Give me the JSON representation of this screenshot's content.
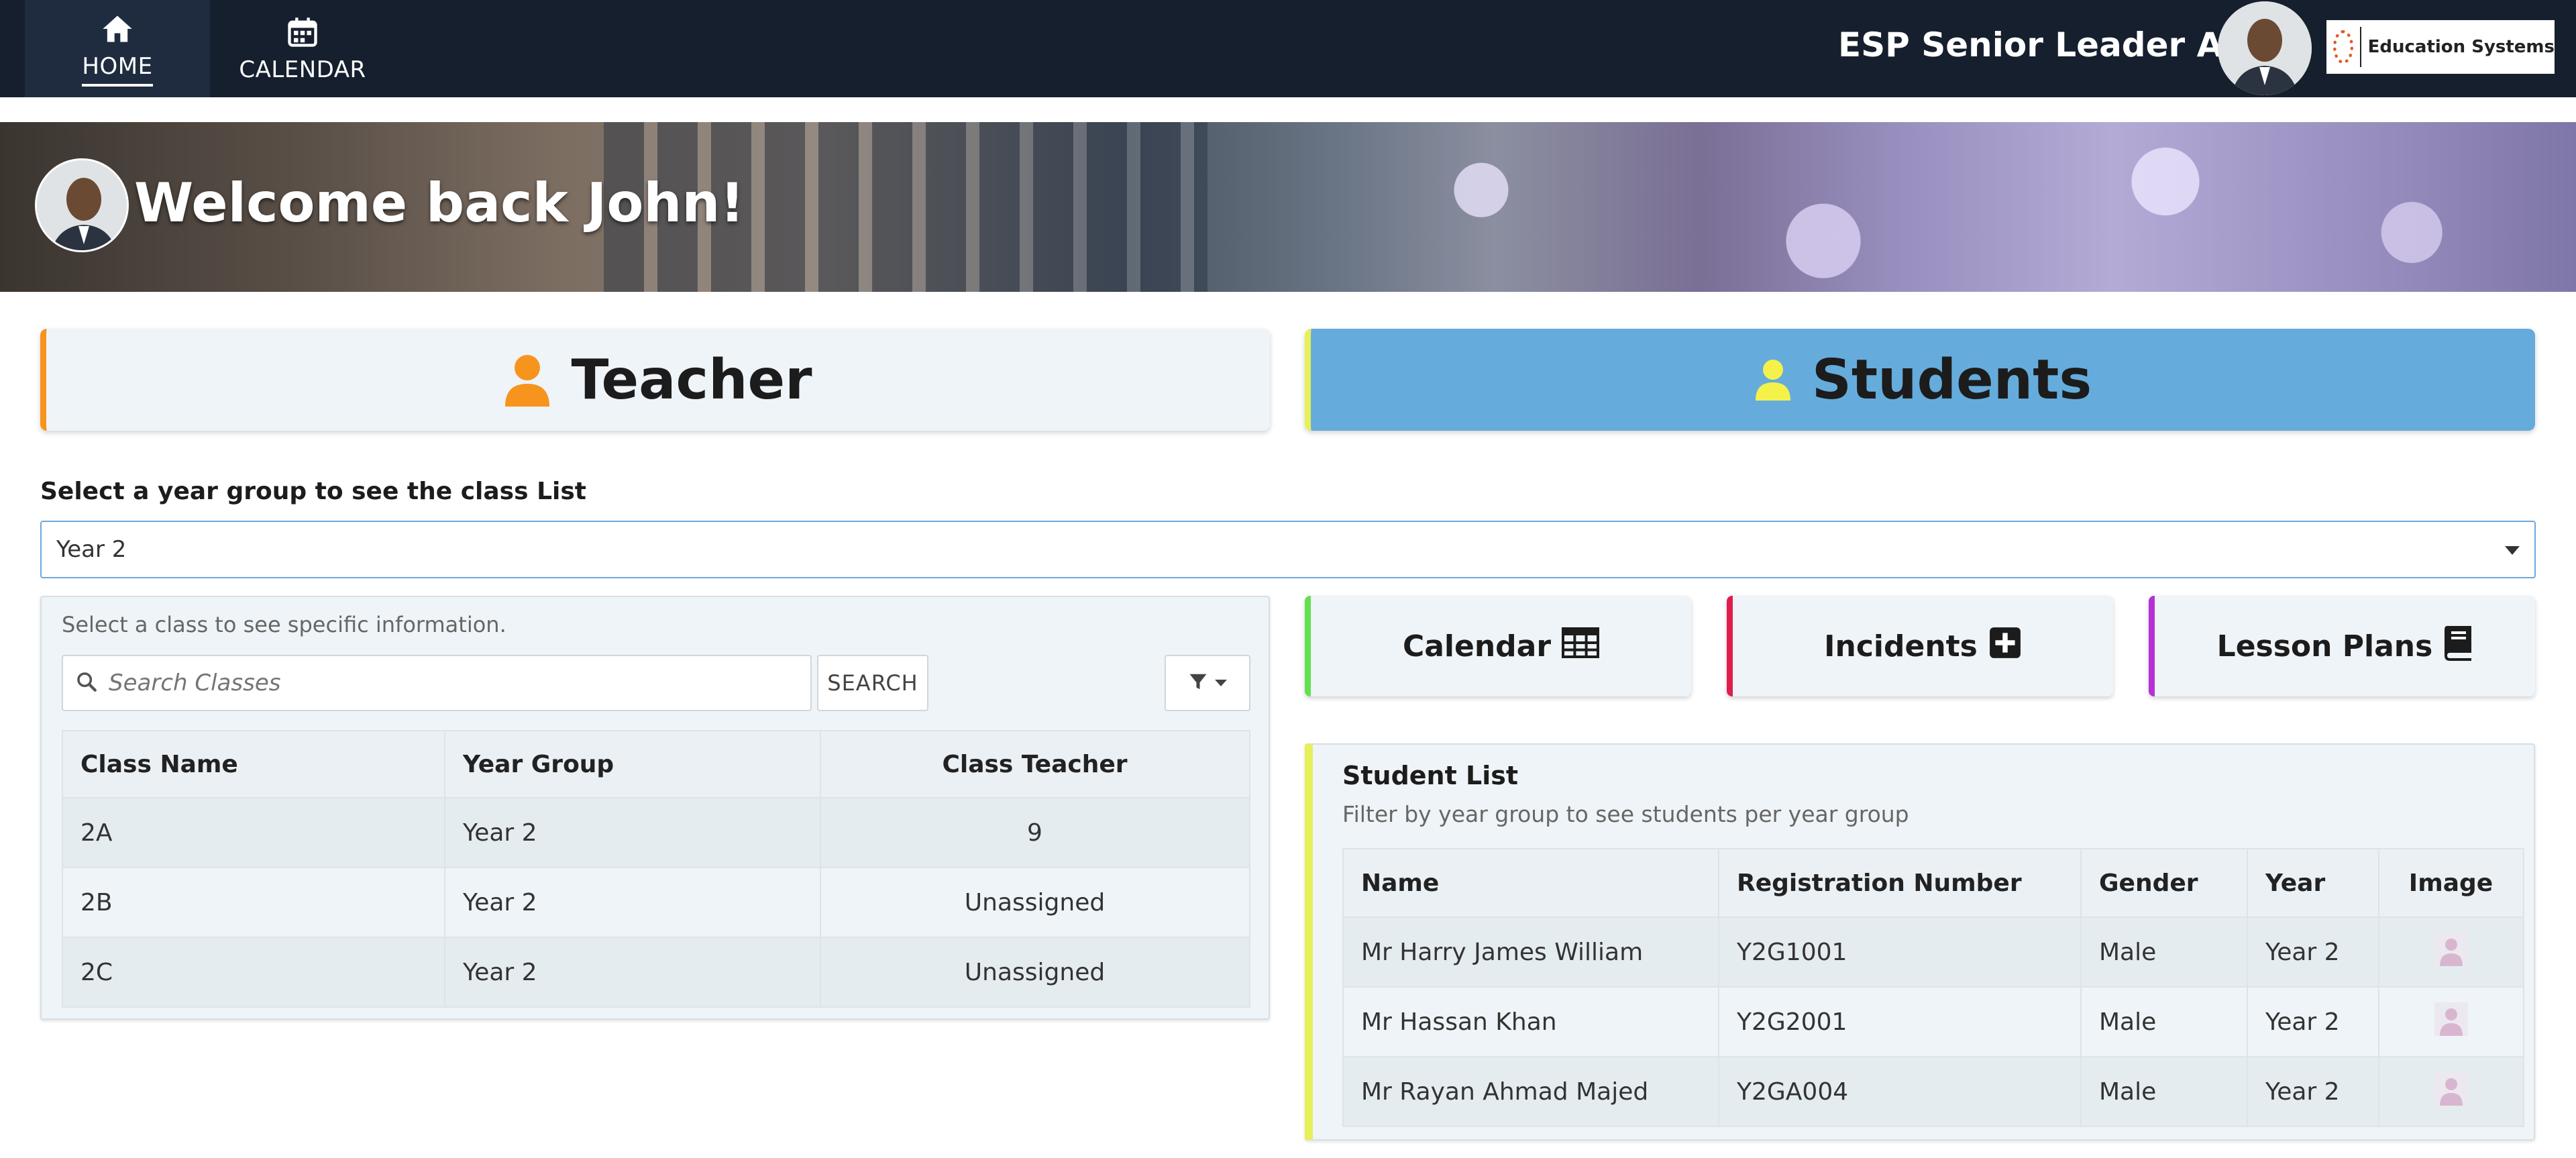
{
  "nav": {
    "home_label": "HOME",
    "calendar_label": "CALENDAR",
    "app_title": "ESP Senior Leader App",
    "logo_text": "Education Systems"
  },
  "banner": {
    "welcome": "Welcome back John!"
  },
  "cards": {
    "teacher": "Teacher",
    "students": "Students"
  },
  "year_select": {
    "label": "Select a year group to see the class List",
    "value": "Year 2"
  },
  "classes": {
    "hint": "Select a class to see specific information.",
    "search_placeholder": "Search Classes",
    "search_button": "SEARCH",
    "headers": [
      "Class Name",
      "Year Group",
      "Class Teacher"
    ],
    "rows": [
      [
        "2A",
        "Year 2",
        "9"
      ],
      [
        "2B",
        "Year 2",
        "Unassigned"
      ],
      [
        "2C",
        "Year 2",
        "Unassigned"
      ]
    ]
  },
  "actions": {
    "calendar": "Calendar",
    "incidents": "Incidents",
    "lesson_plans": "Lesson Plans"
  },
  "students": {
    "title": "Student List",
    "subtitle": "Filter by year group to see students per year group",
    "headers": [
      "Name",
      "Registration Number",
      "Gender",
      "Year",
      "Image"
    ],
    "rows": [
      [
        "Mr Harry James William",
        "Y2G1001",
        "Male",
        "Year 2"
      ],
      [
        "Mr Hassan Khan",
        "Y2G2001",
        "Male",
        "Year 2"
      ],
      [
        "Mr Rayan Ahmad Majed",
        "Y2GA004",
        "Male",
        "Year 2"
      ]
    ]
  },
  "colors": {
    "navbar": "#161f2e",
    "teacher_accent": "#f7941d",
    "students_card": "#65acdc",
    "students_accent": "#e7ef59",
    "calendar_accent": "#63e04e",
    "incidents_accent": "#e01e4e",
    "lesson_accent": "#b630d6"
  },
  "icons": [
    "home-icon",
    "calendar-icon",
    "person-icon",
    "search-icon",
    "filter-icon",
    "table-grid-icon",
    "plus-square-icon",
    "book-icon",
    "user-placeholder-icon"
  ]
}
